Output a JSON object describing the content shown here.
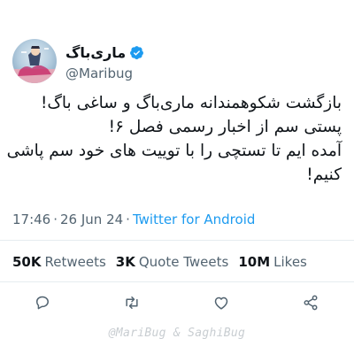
{
  "author": {
    "display_name": "ماری‌باگ",
    "handle": "@Maribug",
    "verified_icon": "verified-badge-icon",
    "avatar_icon": "avatar-illustration"
  },
  "tweet": {
    "text": "بازگشت شکوهمندانه ماری‌باگ و ساغی باگ!\nپستی سم از اخبار رسمی فصل ۶!\nآمده ایم تا تستچی را با توییت های خود سم پاشی کنیم!",
    "time": "17:46",
    "date": "26 Jun 24",
    "source": "Twitter for Android",
    "separator": "·"
  },
  "stats": [
    {
      "count": "50K",
      "label": "Retweets"
    },
    {
      "count": "3K",
      "label": "Quote Tweets"
    },
    {
      "count": "10M",
      "label": "Likes"
    }
  ],
  "actions": [
    {
      "name": "reply-icon"
    },
    {
      "name": "retweet-icon"
    },
    {
      "name": "like-icon"
    },
    {
      "name": "share-icon"
    }
  ],
  "watermark": "@MariBug & SaghiBug",
  "colors": {
    "text": "#0f1419",
    "secondary": "#536471",
    "link": "#1d9bf0",
    "verified": "#1d9bf0",
    "divider": "#e6ecf0",
    "watermark": "#c8cdd1"
  }
}
